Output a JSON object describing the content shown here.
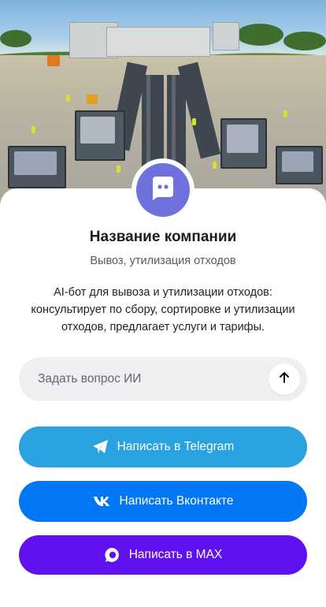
{
  "company": {
    "name": "Название компании",
    "subtitle": "Вывоз, утилизация отходов",
    "description": "AI-бот для вывоза и утилизации отходов: консультирует по сбору, сортировке и утилизации отходов, предлагает услуги и тарифы."
  },
  "ask": {
    "placeholder": "Задать вопрос ИИ",
    "value": ""
  },
  "buttons": {
    "telegram": "Написать в Telegram",
    "vk": "Написать Вконтакте",
    "max": "Написать в MAX"
  },
  "icons": {
    "avatar": "chat-bubble-icon",
    "send": "arrow-up-icon",
    "telegram": "telegram-icon",
    "vk": "vk-icon",
    "max": "max-icon"
  },
  "colors": {
    "avatar": "#6f72dd",
    "telegram": "#2aa1e0",
    "vk": "#0277f6",
    "max": "#5f12ef",
    "ask_background": "#efeff1"
  }
}
